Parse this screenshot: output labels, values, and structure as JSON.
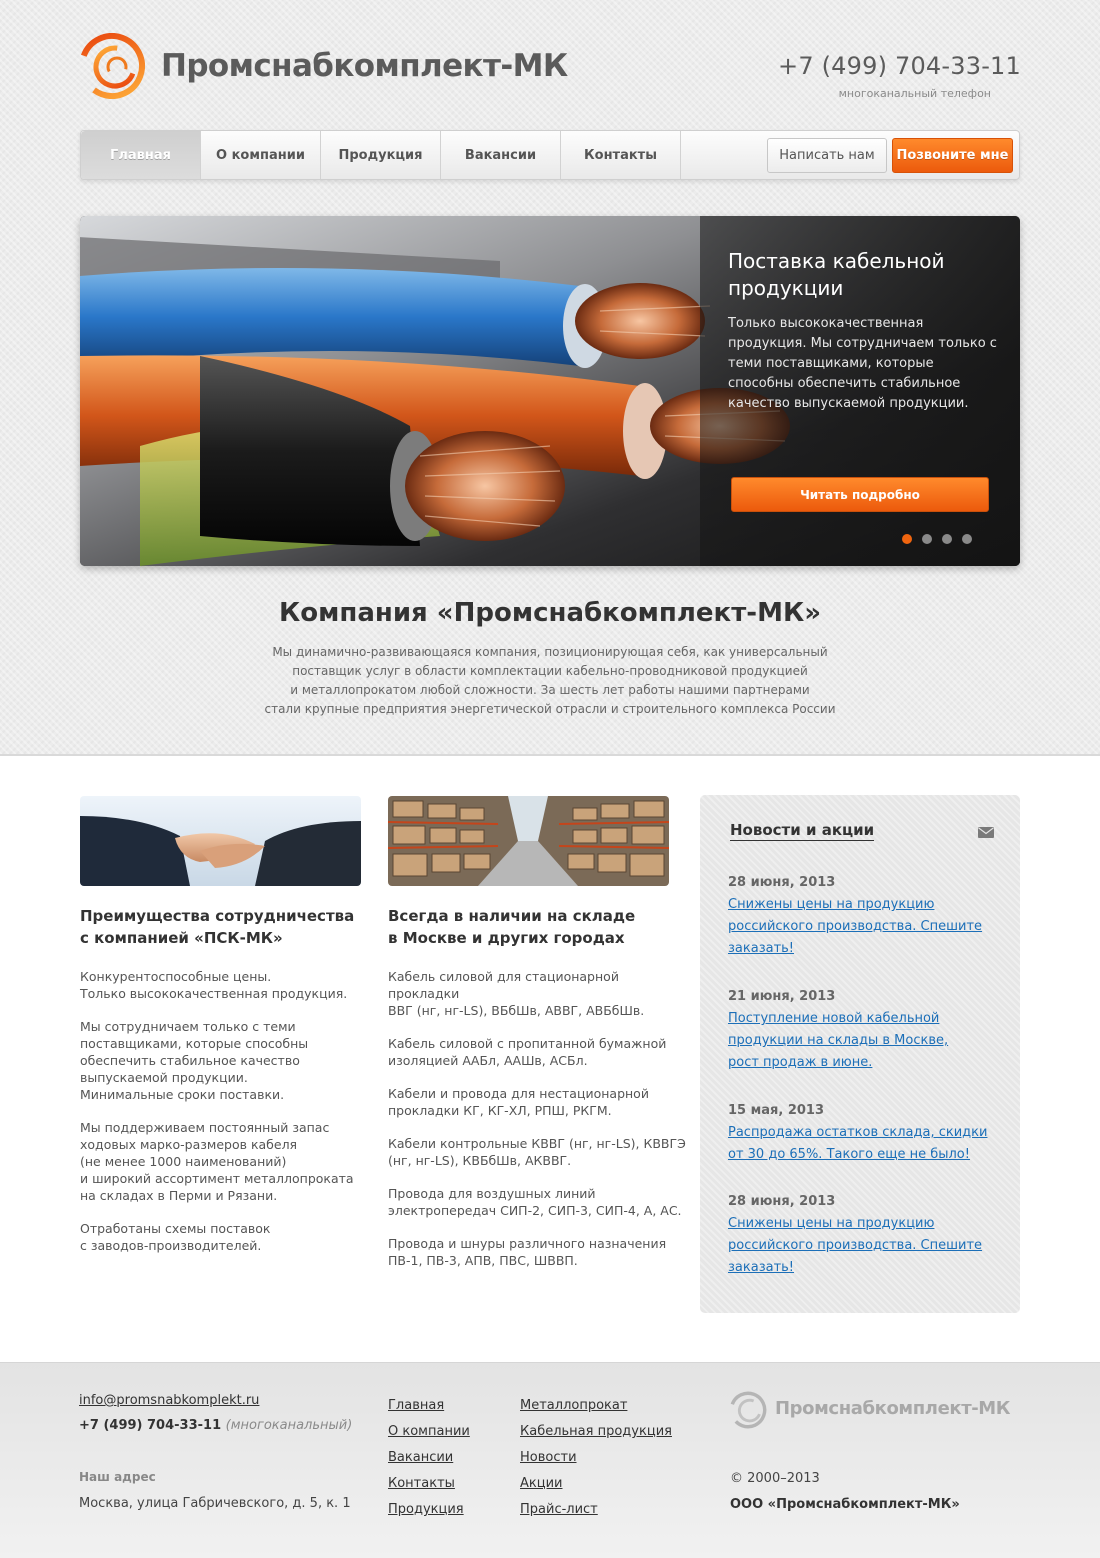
{
  "header": {
    "company_name": "Промснабкомплект-МК",
    "phone": "+7 (499) 704-33-11",
    "phone_note": "многоканальный телефон"
  },
  "nav": {
    "items": [
      {
        "label": "Главная",
        "active": true
      },
      {
        "label": "О компании"
      },
      {
        "label": "Продукция"
      },
      {
        "label": "Вакансии"
      },
      {
        "label": "Контакты"
      }
    ],
    "write_label": "Написать нам",
    "call_label": "Позвоните мне"
  },
  "slider": {
    "title": "Поставка кабельной продукции",
    "text": "Только высококачественная продукция. Мы сотрудничаем только с теми поставщиками, которые способны обеспечить стабильное качество выпускаемой продукции.",
    "button_label": "Читать подробно",
    "slide_count": 4,
    "active_slide": 1
  },
  "intro": {
    "title": "Компания «Промснабкомплект-МК»",
    "lines": [
      "Мы динамично-развивающаяся компания, позиционирующая себя, как универсальный",
      "поставщик услуг в области комплектации кабельно-проводниковой продукцией",
      "и металлопрокатом любой сложности. За шесть лет работы нашими партнерами",
      "стали крупные предприятия энергетической отрасли и строительного комплекса России"
    ]
  },
  "col1": {
    "title_lines": [
      "Преимущества сотрудничества",
      "с компанией «ПСК-МК»"
    ],
    "paragraphs": [
      "Конкурентоспособные цены.\nТолько высококачественная продукция.",
      "Мы сотрудничаем только с теми\nпоставщиками, которые способны\nобеспечить стабильное качество\nвыпускаемой продукции.\nМинимальные сроки поставки.",
      "Мы поддерживаем постоянный запас\nходовых марко-размеров кабеля\n(не менее 1000 наименований)\nи широкий ассортимент металлопроката\nна складах в Перми и Рязани.",
      "Отработаны схемы поставок\nс заводов-производителей."
    ]
  },
  "col2": {
    "title_lines": [
      "Всегда в наличии на складе",
      "в Москве и других городах"
    ],
    "paragraphs": [
      "Кабель силовой для стационарной прокладки\nВВГ (нг, нг-LS), ВБбШв, АВВГ, АВБбШв.",
      "Кабель силовой с пропитанной бумажной\nизоляцией ААБл, ААШв, АСБл.",
      "Кабели и провода для нестационарной\nпрокладки КГ, КГ-ХЛ, РПШ, РКГМ.",
      "Кабели контрольные КВВГ (нг, нг-LS), КВВГЭ\n(нг, нг-LS), КВБбШв, АКВВГ.",
      "Провода для воздушных линий\nэлектропередач СИП-2, СИП-3, СИП-4, А,  АС.",
      "Провода и шнуры различного назначения\nПВ-1, ПВ-3, АПВ, ПВС, ШВВП."
    ]
  },
  "news": {
    "title": "Новости и акции",
    "items": [
      {
        "date": "28 июня, 2013",
        "text": "Снижены цены на продукцию\nроссийского производства. Спешите\nзаказать!"
      },
      {
        "date": "21 июня, 2013",
        "text": "Поступление новой кабельной\nпродукции на склады в Москве,\nрост продаж в июне."
      },
      {
        "date": "15 мая, 2013",
        "text": "Распродажа остатков склада, скидки\nот 30 до 65%. Такого еще не было!"
      },
      {
        "date": "28 июня, 2013",
        "text": "Снижены цены на продукцию\nроссийского производства. Спешите\nзаказать!"
      }
    ]
  },
  "footer": {
    "email": "info@promsnabkomplekt.ru",
    "phone": "+7 (499) 704-33-11",
    "phone_note": "(многоканальный)",
    "address_label": "Наш адрес",
    "address": "Москва, улица Габричевского, д. 5, к. 1",
    "links_col1": [
      "Главная",
      "О компании",
      "Вакансии",
      "Контакты",
      "Продукция"
    ],
    "links_col2": [
      "Металлопрокат",
      "Кабельная продукция",
      "Новости",
      "Акции",
      "Прайс-лист"
    ],
    "logo_text": "Промснабкомплект-МК",
    "copyright": "© 2000–2013",
    "org": "ООО «Промснабкомплект-МК»"
  },
  "colors": {
    "accent": "#f0650f",
    "link": "#1c6fb8",
    "text": "#333333"
  }
}
